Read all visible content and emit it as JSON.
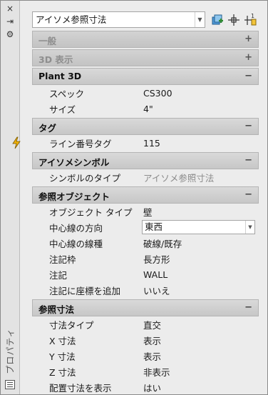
{
  "palette": {
    "close": "×",
    "pin": "⇥",
    "settings": "⚙",
    "title": "プロパティ"
  },
  "toolbar": {
    "object_type": "アイソメ参照寸法",
    "icons": [
      "quick-select-icon",
      "select-objects-icon",
      "toggle-pickadd-icon"
    ]
  },
  "sections": [
    {
      "title": "一般",
      "collapsed": true,
      "toggle": "+"
    },
    {
      "title": "3D 表示",
      "collapsed": true,
      "toggle": "+"
    },
    {
      "title": "Plant 3D",
      "collapsed": false,
      "toggle": "−",
      "rows": [
        {
          "label": "スペック",
          "value": "CS300"
        },
        {
          "label": "サイズ",
          "value": "4\""
        }
      ]
    },
    {
      "title": "タグ",
      "collapsed": false,
      "toggle": "−",
      "rows": [
        {
          "label": "ライン番号タグ",
          "value": "115",
          "marker": "lightning-icon"
        }
      ]
    },
    {
      "title": "アイソメシンボル",
      "collapsed": false,
      "toggle": "−",
      "rows": [
        {
          "label": "シンボルのタイプ",
          "value": "アイソメ参照寸法",
          "dim": true
        }
      ]
    },
    {
      "title": "参照オブジェクト",
      "collapsed": false,
      "toggle": "−",
      "rows": [
        {
          "label": "オブジェクト タイプ",
          "value": "壁"
        },
        {
          "label": "中心線の方向",
          "value": "東西",
          "dropdown": true
        },
        {
          "label": "中心線の線種",
          "value": "破線/既存"
        },
        {
          "label": "注記枠",
          "value": "長方形"
        },
        {
          "label": "注記",
          "value": "WALL"
        },
        {
          "label": "注記に座標を追加",
          "value": "いいえ"
        }
      ]
    },
    {
      "title": "参照寸法",
      "collapsed": false,
      "toggle": "−",
      "rows": [
        {
          "label": "寸法タイプ",
          "value": "直交"
        },
        {
          "label": "X 寸法",
          "value": "表示"
        },
        {
          "label": "Y 寸法",
          "value": "表示"
        },
        {
          "label": "Z 寸法",
          "value": "非表示"
        },
        {
          "label": "配置寸法を表示",
          "value": "はい"
        }
      ]
    }
  ]
}
